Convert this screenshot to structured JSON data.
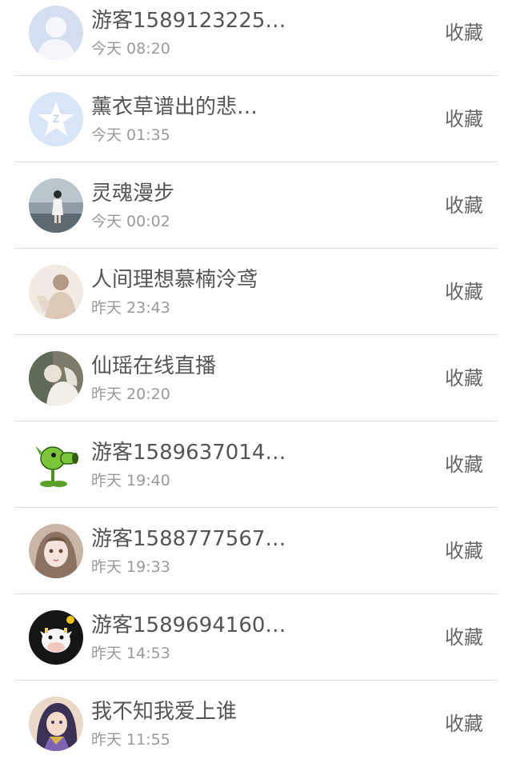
{
  "collect_label": "收藏",
  "items": [
    {
      "name": "游客1589123225…",
      "time": "今天 08:20",
      "avatar": "default-user-avatar"
    },
    {
      "name": "薰衣草谱出的悲…",
      "time": "今天 01:35",
      "avatar": "qq-star-avatar"
    },
    {
      "name": "灵魂漫步",
      "time": "今天 00:02",
      "avatar": "photo-avatar"
    },
    {
      "name": "人间理想慕楠泠鸢",
      "time": "昨天 23:43",
      "avatar": "photo-avatar"
    },
    {
      "name": "仙瑶在线直播",
      "time": "昨天 20:20",
      "avatar": "photo-avatar"
    },
    {
      "name": "游客1589637014…",
      "time": "昨天 19:40",
      "avatar": "peashooter-avatar"
    },
    {
      "name": "游客1588777567…",
      "time": "昨天 19:33",
      "avatar": "anime-girl-avatar"
    },
    {
      "name": "游客1589694160…",
      "time": "昨天 14:53",
      "avatar": "cow-avatar"
    },
    {
      "name": "我不知我爱上谁",
      "time": "昨天 11:55",
      "avatar": "anime-character-avatar"
    }
  ]
}
